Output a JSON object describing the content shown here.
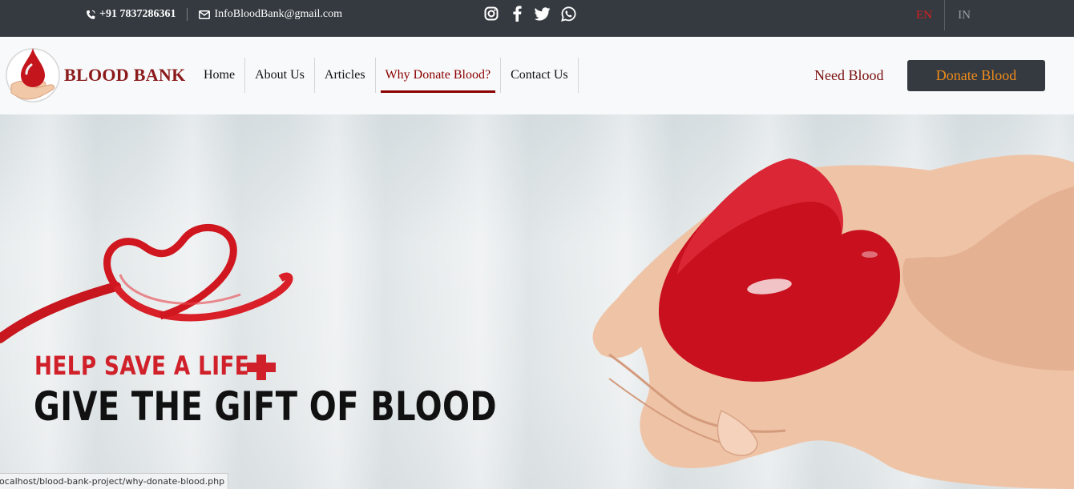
{
  "topbar": {
    "phone": "+91 7837286361",
    "email": "InfoBloodBank@gmail.com",
    "social_icons": [
      "instagram-icon",
      "facebook-icon",
      "twitter-icon",
      "whatsapp-icon"
    ],
    "lang_en": "EN",
    "lang_in": "IN"
  },
  "brand": {
    "name": "BLOOD BANK"
  },
  "nav": {
    "items": [
      {
        "label": "Home"
      },
      {
        "label": "About Us"
      },
      {
        "label": "Articles"
      },
      {
        "label": "Why Donate Blood?",
        "active": true
      },
      {
        "label": "Contact Us"
      }
    ],
    "need_blood": "Need Blood",
    "donate_blood": "Donate Blood"
  },
  "hero": {
    "line1": "HELP SAVE A LIFE",
    "line2": "GIVE THE GIFT OF BLOOD"
  },
  "status_url": "localhost/blood-bank-project/why-donate-blood.php",
  "colors": {
    "topbar_bg": "#343a40",
    "navbar_bg": "#f8f9fa",
    "brand_red": "#8b1a1a",
    "active_red": "#8b0000",
    "lang_active": "#dc1e1e",
    "lang_inactive": "#9aa0a6",
    "donate_text": "#f08c1c",
    "hero_red": "#d0202a"
  }
}
